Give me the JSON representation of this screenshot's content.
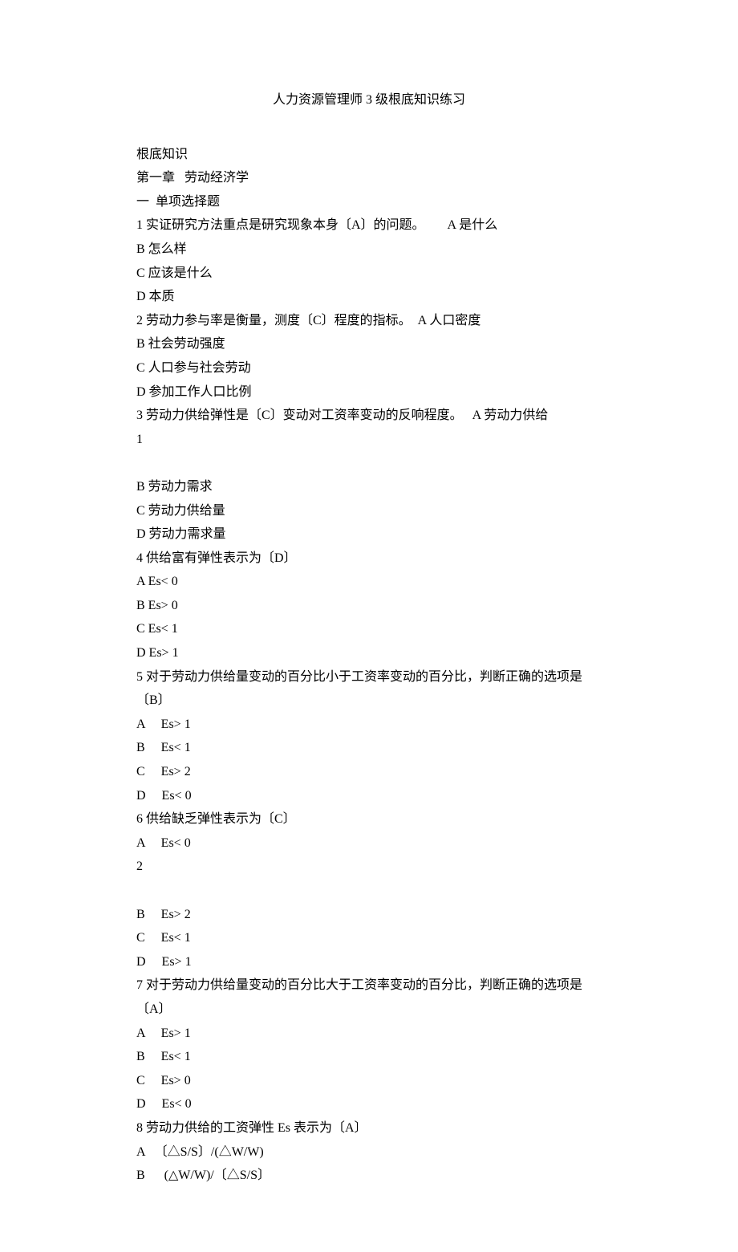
{
  "title": "人力资源管理师 3 级根底知识练习",
  "lines": [
    "根底知识",
    "第一章   劳动经济学",
    "一  单项选择题",
    "1 实证研究方法重点是研究现象本身〔A〕的问题。       A 是什么",
    "B 怎么样",
    "C 应该是什么",
    "D 本质",
    "2 劳动力参与率是衡量，测度〔C〕程度的指标。  A 人口密度",
    "B 社会劳动强度",
    "C 人口参与社会劳动",
    "D 参加工作人口比例",
    "3 劳动力供给弹性是〔C〕变动对工资率变动的反响程度。   A 劳动力供给",
    "1",
    "",
    "B 劳动力需求",
    "C 劳动力供给量",
    "D 劳动力需求量",
    "4 供给富有弹性表示为〔D〕",
    "A Es< 0",
    "B Es> 0",
    "C Es< 1",
    "D Es> 1",
    "5 对于劳动力供给量变动的百分比小于工资率变动的百分比，判断正确的选项是〔B〕",
    "A     Es> 1",
    "B     Es< 1",
    "C     Es> 2",
    "D     Es< 0",
    "6 供给缺乏弹性表示为〔C〕",
    "A     Es< 0",
    "2",
    "",
    "B     Es> 2",
    "C     Es< 1",
    "D     Es> 1",
    "7 对于劳动力供给量变动的百分比大于工资率变动的百分比，判断正确的选项是〔A〕",
    "A     Es> 1",
    "B     Es< 1",
    "C     Es> 0",
    "D     Es< 0",
    "8 劳动力供给的工资弹性 Es 表示为〔A〕",
    "A   〔△S/S〕/(△W/W)",
    "B      (△W/W)/〔△S/S〕"
  ]
}
